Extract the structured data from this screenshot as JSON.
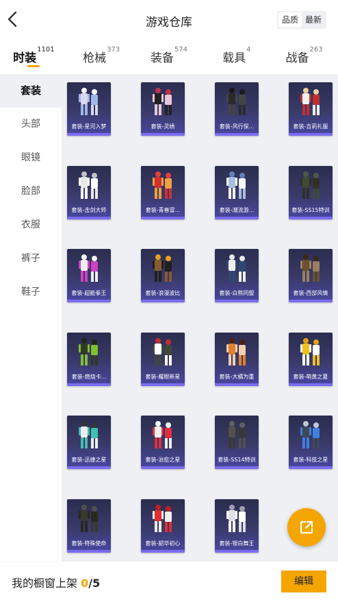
{
  "header": {
    "title": "游戏仓库"
  },
  "sort": {
    "options": [
      "品质",
      "最新"
    ],
    "active": 0
  },
  "tabs": [
    {
      "label": "时装",
      "count": "1101"
    },
    {
      "label": "枪械",
      "count": "373"
    },
    {
      "label": "装备",
      "count": "574"
    },
    {
      "label": "载具",
      "count": "4"
    },
    {
      "label": "战备",
      "count": "263"
    }
  ],
  "sidebar": {
    "items": [
      "套装",
      "头部",
      "眼镜",
      "脸部",
      "衣服",
      "裤子",
      "鞋子"
    ]
  },
  "items": [
    {
      "name": "套装-星河入梦",
      "palette": [
        "#d8d8f0",
        "#a0b8e8",
        "#ffffff"
      ]
    },
    {
      "name": "套装-灵绣",
      "palette": [
        "#222222",
        "#e8c8d8",
        "#c03050"
      ]
    },
    {
      "name": "套装-风行保...",
      "palette": [
        "#2a2a2a",
        "#444444",
        "#1a1a1a"
      ]
    },
    {
      "name": "套装-吉莉礼服",
      "palette": [
        "#f0f0f0",
        "#c03030",
        "#e8d0a0"
      ]
    },
    {
      "name": "套装-击剑大师",
      "palette": [
        "#e8e8e8",
        "#ffffff",
        "#c0c0c8"
      ]
    },
    {
      "name": "套装-青春冒...",
      "palette": [
        "#d03030",
        "#f0a040",
        "#e04040"
      ]
    },
    {
      "name": "套装-潮流游...",
      "palette": [
        "#a8c0e0",
        "#ffffff",
        "#6080c0"
      ]
    },
    {
      "name": "套装-SS15特训",
      "palette": [
        "#404838",
        "#303028",
        "#505848"
      ]
    },
    {
      "name": "套装-超能拳王",
      "palette": [
        "#f0f0f0",
        "#d040c0",
        "#ffffff"
      ]
    },
    {
      "name": "套装-浪漫波比",
      "palette": [
        "#8a5a30",
        "#202020",
        "#e8a020"
      ]
    },
    {
      "name": "套装-白熊同盟",
      "palette": [
        "#f0f0f0",
        "#304870",
        "#e8e8e8"
      ]
    },
    {
      "name": "套装-西部风情",
      "palette": [
        "#6a5030",
        "#9a8060",
        "#3a2818"
      ]
    },
    {
      "name": "套装-燃烧卡...",
      "palette": [
        "#303a28",
        "#80c030",
        "#202818"
      ]
    },
    {
      "name": "套装-耀眼新星",
      "palette": [
        "#ffffff",
        "#404838",
        "#c03030"
      ]
    },
    {
      "name": "套装-大橘为重",
      "palette": [
        "#e08030",
        "#f0d0b0",
        "#502010"
      ]
    },
    {
      "name": "套装-萌黄之夏",
      "palette": [
        "#f0c020",
        "#ffffff",
        "#e0a010"
      ]
    },
    {
      "name": "套装-迅捷之星",
      "palette": [
        "#e8f0f0",
        "#40c0b0",
        "#303838"
      ]
    },
    {
      "name": "套装-治愈之星",
      "palette": [
        "#f0f0f0",
        "#e03040",
        "#ffffff"
      ]
    },
    {
      "name": "套装-SS14特训",
      "palette": [
        "#505050",
        "#383838",
        "#606060"
      ]
    },
    {
      "name": "套装-科技之星",
      "palette": [
        "#404858",
        "#4080e0",
        "#c0c8d8"
      ]
    },
    {
      "name": "套装-特殊使命",
      "palette": [
        "#383830",
        "#282820",
        "#505048"
      ]
    },
    {
      "name": "套装-韶华初心",
      "palette": [
        "#e03030",
        "#f0f0f0",
        "#c02020"
      ]
    },
    {
      "name": "套装-银白舞王",
      "palette": [
        "#e0e0e8",
        "#ffffff",
        "#a0a0b0"
      ]
    }
  ],
  "bottom": {
    "label": "我的橱窗上架",
    "count": "0",
    "total": "/5",
    "edit_label": "编辑"
  },
  "colors": {
    "accent": "#f5a500",
    "card_bottom": "#7b6cf0"
  },
  "icons": {
    "back": "chevron-left-icon",
    "share": "share-out-icon"
  }
}
